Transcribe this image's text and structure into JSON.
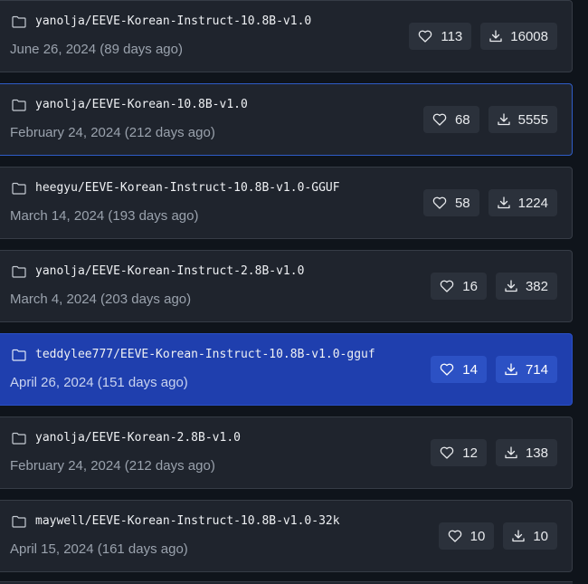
{
  "repos": [
    {
      "name": "yanolja/EEVE-Korean-Instruct-10.8B-v1.0",
      "date": "June 26, 2024 (89 days ago)",
      "likes": "113",
      "downloads": "16008"
    },
    {
      "name": "yanolja/EEVE-Korean-10.8B-v1.0",
      "date": "February 24, 2024 (212 days ago)",
      "likes": "68",
      "downloads": "5555"
    },
    {
      "name": "heegyu/EEVE-Korean-Instruct-10.8B-v1.0-GGUF",
      "date": "March 14, 2024 (193 days ago)",
      "likes": "58",
      "downloads": "1224"
    },
    {
      "name": "yanolja/EEVE-Korean-Instruct-2.8B-v1.0",
      "date": "March 4, 2024 (203 days ago)",
      "likes": "16",
      "downloads": "382"
    },
    {
      "name": "teddylee777/EEVE-Korean-Instruct-10.8B-v1.0-gguf",
      "date": "April 26, 2024 (151 days ago)",
      "likes": "14",
      "downloads": "714"
    },
    {
      "name": "yanolja/EEVE-Korean-2.8B-v1.0",
      "date": "February 24, 2024 (212 days ago)",
      "likes": "12",
      "downloads": "138"
    },
    {
      "name": "maywell/EEVE-Korean-Instruct-10.8B-v1.0-32k",
      "date": "April 15, 2024 (161 days ago)",
      "likes": "10",
      "downloads": "10"
    }
  ],
  "icons": {
    "folder": "folder-icon",
    "like": "heart-icon",
    "download": "download-icon"
  },
  "colors": {
    "card_background": "#1f242d",
    "card_border": "#363c46",
    "hover_border": "#2f5dc7",
    "selected_background": "#1f3fae",
    "pill_background": "#2b313b",
    "text_primary": "#eef0f3",
    "text_secondary": "#9aa2ad"
  },
  "state": {
    "hovered_index": 1,
    "selected_index": 4
  }
}
